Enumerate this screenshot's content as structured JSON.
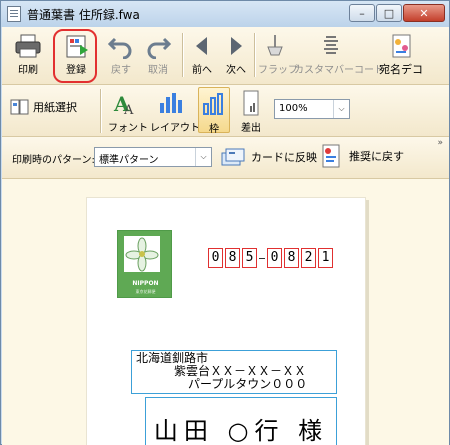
{
  "window": {
    "title": "普通葉書 住所録.fwa",
    "buttons": [
      "minimize",
      "maximize",
      "close"
    ]
  },
  "toolbar1": {
    "print": "印刷",
    "register": "登録",
    "undo": "戻す",
    "cancel": "取消",
    "prev": "前へ",
    "next": "次へ",
    "flap": "フラップ",
    "custom_barcode": "カスタマバーコード",
    "addressee_deco": "宛名デコ"
  },
  "toolbar2": {
    "paper_select": "用紙選択",
    "font": "フォント",
    "layout": "レイアウト",
    "frame": "枠",
    "sender": "差出",
    "zoom_value": "100%"
  },
  "toolbar3": {
    "print_pattern_label": "印刷時のパターン:",
    "pattern_value": "標準パターン",
    "apply_to_card": "カードに反映",
    "revert_recommended": "推奨に戻す"
  },
  "postcard": {
    "zip_digits": [
      "0",
      "8",
      "5",
      "0",
      "8",
      "2",
      "1"
    ],
    "stamp_text": "NIPPON",
    "stamp_sub": "東京花郵便",
    "address_lines": [
      "北海道釧路市",
      "紫雲台ＸＸ－ＸＸ－ＸＸ",
      "パープルタウン０００"
    ],
    "name": "山田 ○行 様"
  },
  "colors": {
    "highlight": "#e23030",
    "zip_box": "#e03030",
    "address_box": "#3ca0d8",
    "stamp_green": "#5fa954"
  }
}
